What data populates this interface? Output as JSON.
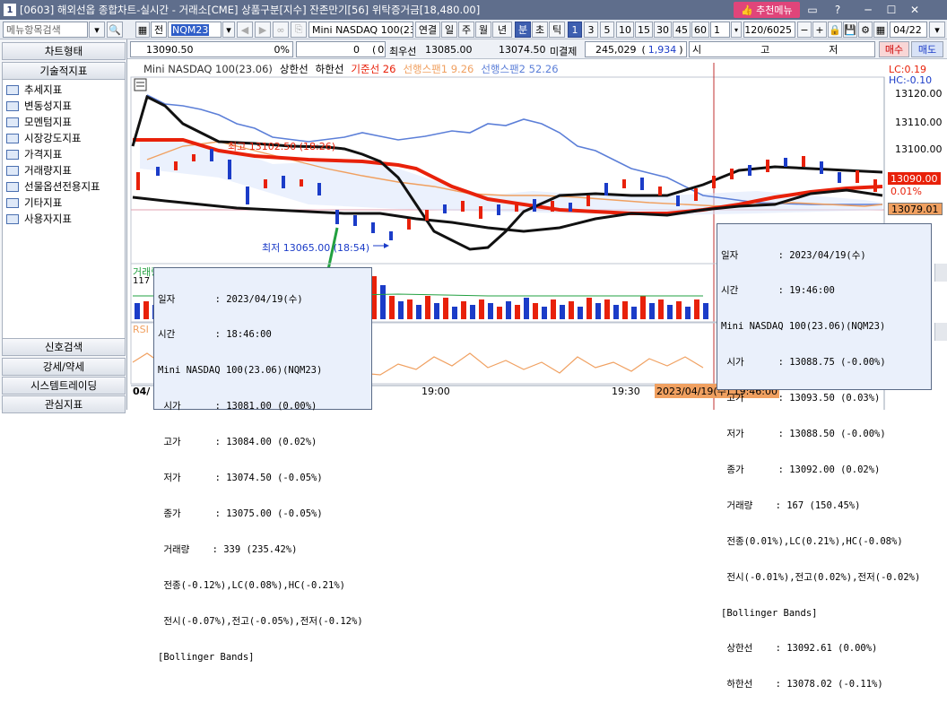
{
  "titlebar": {
    "num": "1",
    "title": "[0603] 해외선옵 종합차트-실시간 - 거래소[CME] 상품구분[지수] 잔존만기[56] 위탁증거금[18,480.00]",
    "recommend": "추천메뉴",
    "icons": [
      "screen-icon",
      "help-icon",
      "minimize-icon",
      "maximize-icon",
      "close-icon"
    ]
  },
  "toolbar": {
    "menu_search_placeholder": "메뉴항목검색",
    "all_label": "전",
    "code_value": "NQM23",
    "product_name": "Mini NASDAQ 100(23.0",
    "period_buttons": [
      "연결",
      "일",
      "주",
      "월",
      "년",
      "분",
      "초",
      "틱"
    ],
    "selected_period": "분",
    "minute_buttons": [
      "1",
      "3",
      "5",
      "10",
      "15",
      "30",
      "45",
      "60"
    ],
    "selected_minute": "1",
    "spin_value": "1",
    "count_value": "120/6025",
    "date_value": "04/22"
  },
  "quote_bar": {
    "price": "13090.50",
    "change_pct": "0%",
    "volume": "0",
    "vol_pct": "0%",
    "best_bid_label": "최우선",
    "best_bid": "13085.00",
    "best_ask": "13074.50",
    "open_interest_label": "미결제",
    "open_interest": "245,029",
    "oi_change": "1,934",
    "time_label": "시",
    "time_mid": "고",
    "time_end": "저",
    "buy_label": "매수",
    "sell_label": "매도"
  },
  "sidebar": {
    "head1": "차트형태",
    "head2": "기술적지표",
    "items": [
      "추세지표",
      "변동성지표",
      "모멘텀지표",
      "시장강도지표",
      "가격지표",
      "거래량지표",
      "선물옵션전용지표",
      "기타지표",
      "사용자지표"
    ],
    "bottom": [
      "신호검색",
      "강세/약세",
      "시스템트레이딩",
      "관심지표"
    ]
  },
  "chart_header": {
    "product": "Mini NASDAQ 100(23.06)",
    "upper": "상한선",
    "lower": "하한선",
    "base_line": "기준선 26",
    "span1": "선행스팬1 9.26",
    "span2": "선행스팬2 52.26",
    "lc": "LC:0.19",
    "hc": "HC:-0.10"
  },
  "chart_data": {
    "type": "line",
    "y_ticks": [
      "13120.00",
      "13110.00",
      "13100.00",
      "13090.00",
      "13079.01"
    ],
    "ylim": [
      13060,
      13125
    ],
    "x_ticks": [
      "04/",
      "19:00",
      "19:30"
    ],
    "current_price_box": "13090.00",
    "current_pct_box": "0.01%",
    "low_price_box": "13079.01",
    "high_annotation": "최고 13102.50 (18:26)",
    "low_annotation": "최저 13065.00 (18:54)",
    "cursor_time_box": "2023/04/19(수) 19:46:00",
    "lower_panel_labels": [
      "거래량",
      "RSI"
    ],
    "volume_axis": "117"
  },
  "tooltip_left": {
    "lines": [
      "일자       : 2023/04/19(수)",
      "시간       : 18:46:00",
      "Mini NASDAQ 100(23.06)(NQM23)",
      " 시가      : 13081.00 (0.00%)",
      " 고가      : 13084.00 (0.02%)",
      " 저가      : 13074.50 (-0.05%)",
      " 종가      : 13075.00 (-0.05%)",
      " 거래량    : 339 (235.42%)",
      " 전종(-0.12%),LC(0.08%),HC(-0.21%)",
      " 전시(-0.07%),전고(-0.05%),전저(-0.12%)",
      "[Bollinger Bands]"
    ]
  },
  "tooltip_right": {
    "lines": [
      "일자       : 2023/04/19(수)",
      "시간       : 19:46:00",
      "Mini NASDAQ 100(23.06)(NQM23)",
      " 시가      : 13088.75 (-0.00%)",
      " 고가      : 13093.50 (0.03%)",
      " 저가      : 13088.50 (-0.00%)",
      " 종가      : 13092.00 (0.02%)",
      " 거래량    : 167 (150.45%)",
      " 전종(0.01%),LC(0.21%),HC(-0.08%)",
      " 전시(-0.01%),전고(0.02%),전저(-0.02%)",
      "[Bollinger Bands]",
      " 상한선    : 13092.61 (0.00%)",
      " 하한선    : 13078.02 (-0.11%)"
    ]
  }
}
